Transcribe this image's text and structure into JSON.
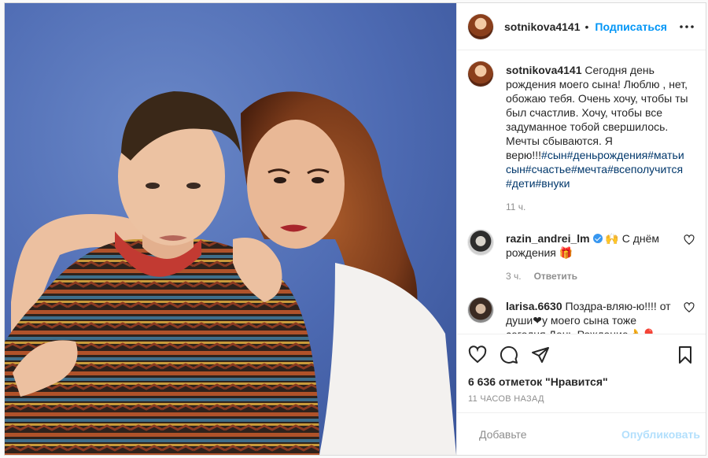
{
  "post": {
    "author": {
      "username": "sotnikova4141",
      "follow_label": "Подписаться",
      "separator": "•"
    },
    "caption": {
      "username": "sotnikova4141",
      "text": "Сегодня день рождения моего сына! Люблю , нет, обожаю тебя. Очень хочу, чтобы ты был счастлив. Хочу, чтобы все задуманное тобой свершилось. Мечты сбываются. Я верю!!!",
      "hashtags": "#сын#деньрождения#матьи сын#счастье#мечта#всеполучится #дети#внуки",
      "time": "11 ч."
    },
    "comments": [
      {
        "username": "razin_andrei_lm",
        "verified": true,
        "text": "🙌 С днём рождения 🎁",
        "time": "3 ч.",
        "reply_label": "Ответить"
      },
      {
        "username": "larisa.6630",
        "verified": false,
        "text": "Поздра-вляю-ю!!!! от души❤у моего сына тоже сегодня День Рождение👌🎈"
      }
    ],
    "likes": "6 636 отметок \"Нравится\"",
    "posted_ago": "11 часов назад",
    "add_comment": {
      "placeholder": "Добавьте",
      "publish_label": "Опубликовать"
    }
  },
  "colors": {
    "accent": "#0095f6",
    "hashtag": "#00376b",
    "publish_disabled": "#b2dffc",
    "photo_backdrop": "#4f6db4"
  },
  "icons": [
    "more-options-icon",
    "heart-icon",
    "comment-icon",
    "share-icon",
    "bookmark-icon",
    "emoji-icon",
    "verified-badge-icon"
  ]
}
